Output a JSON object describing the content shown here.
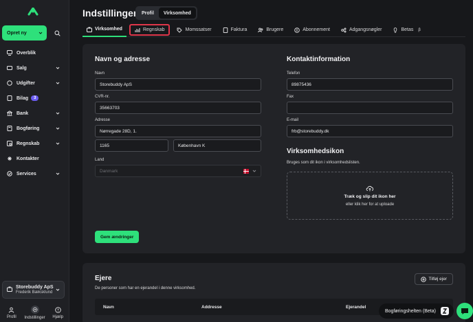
{
  "sidebar": {
    "create_label": "Opret ny",
    "items": [
      {
        "label": "Overblik",
        "icon": "monitor-icon",
        "chevron": false
      },
      {
        "label": "Salg",
        "icon": "cart-icon",
        "chevron": true
      },
      {
        "label": "Udgifter",
        "icon": "receipt-icon",
        "chevron": true
      },
      {
        "label": "Bilag",
        "icon": "document-icon",
        "chevron": false,
        "badge": "3"
      },
      {
        "label": "Bank",
        "icon": "bank-icon",
        "chevron": true
      },
      {
        "label": "Bogføring",
        "icon": "book-icon",
        "chevron": true
      },
      {
        "label": "Regnskab",
        "icon": "report-icon",
        "chevron": true
      },
      {
        "label": "Kontakter",
        "icon": "contacts-icon",
        "chevron": false
      },
      {
        "label": "Services",
        "icon": "services-icon",
        "chevron": true
      }
    ],
    "company": {
      "name": "Storebuddy ApS",
      "user": "Frederik Bæksklund"
    },
    "bottom": [
      {
        "label": "Profil",
        "icon": "user-icon"
      },
      {
        "label": "Indstillinger",
        "icon": "gear-icon"
      },
      {
        "label": "Hjælp",
        "icon": "help-icon"
      }
    ]
  },
  "header": {
    "title": "Indstillinger",
    "segments": [
      "Profil",
      "Virksomhed"
    ],
    "active_segment": "Virksomhed"
  },
  "tabs": [
    {
      "label": "Virksomhed",
      "icon": "briefcase-icon"
    },
    {
      "label": "Regnskab",
      "icon": "bar-chart-icon"
    },
    {
      "label": "Momssatser",
      "icon": "tag-icon"
    },
    {
      "label": "Faktura",
      "icon": "invoice-icon"
    },
    {
      "label": "Brugere",
      "icon": "users-icon"
    },
    {
      "label": "Abonnement",
      "icon": "subscription-icon"
    },
    {
      "label": "Adgangsnøgler",
      "icon": "key-icon"
    },
    {
      "label": "Betas",
      "icon": "lightbulb-icon",
      "badge": "β"
    }
  ],
  "address": {
    "heading": "Navn og adresse",
    "name_label": "Navn",
    "name_value": "Storebuddy ApS",
    "cvr_label": "CVR-nr.",
    "cvr_value": "35663703",
    "address_label": "Adresse",
    "address_value": "Nørregade 28D, 1.",
    "zip_value": "1165",
    "city_value": "København K",
    "country_label": "Land",
    "country_value": "Danmark"
  },
  "contact": {
    "heading": "Kontaktinformation",
    "phone_label": "Telefon",
    "phone_value": "89875436",
    "fax_label": "Fax",
    "fax_value": "",
    "email_label": "E-mail",
    "email_value": "frb@storebuddy.dk"
  },
  "company_icon": {
    "heading": "Virksomhedsikon",
    "description": "Bruges som dit ikon i virksomhedslisten.",
    "drop_main": "Træk og slip dit ikon her",
    "drop_sub": "eller klik her for at uploade"
  },
  "save_label": "Gem ændringer",
  "owners": {
    "heading": "Ejere",
    "description": "De personer som har en ejerandel i denne virksomhed.",
    "add_label": "Tilføj ejer",
    "columns": [
      "Navn",
      "Addresse",
      "Ejerandel"
    ]
  },
  "helper": {
    "label": "Bogføringshelten (Beta)"
  },
  "colors": {
    "accent": "#2ee07b",
    "highlight": "#e0364a",
    "badge": "#6b5cf0"
  }
}
